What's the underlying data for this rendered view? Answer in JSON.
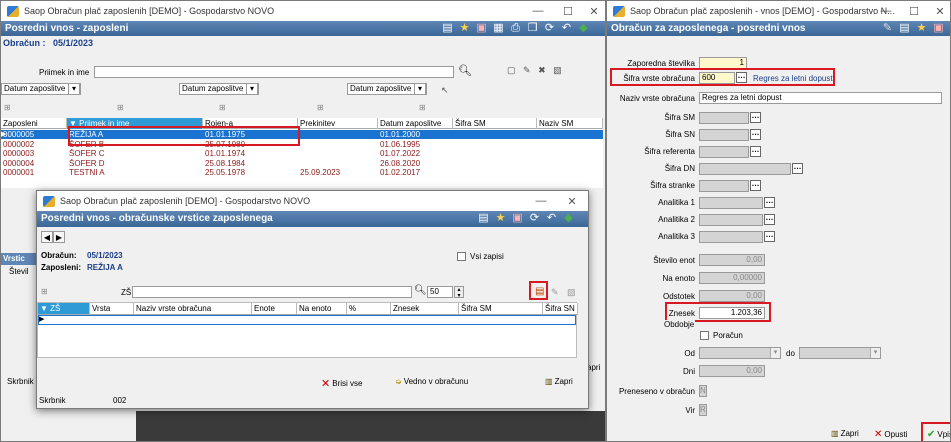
{
  "left_window": {
    "title": "Saop Obračun plač zaposlenih [DEMO] - Gospodarstvo NOVO",
    "band": "Posredni vnos - zaposleni",
    "obracun_label": "Obračun :",
    "obracun_value": "05/1/2023",
    "search_label": "Priimek in ime",
    "search_value": "",
    "date1": "Datum zaposlitve",
    "date2": "Datum zaposlitve",
    "date3": "Datum zaposlitve",
    "columns": [
      "Zaposleni",
      "Priimek in ime",
      "Rojen-a",
      "Prekinitev",
      "Datum zaposlitve",
      "Šifra SM",
      "Naziv SM"
    ],
    "rows": [
      [
        "0000005",
        "REŽIJA A",
        "01.01.1975",
        "",
        "01.01.2000",
        "",
        ""
      ],
      [
        "0000002",
        "ŠOFER B",
        "25.07.1980",
        "",
        "01.06.1995",
        "",
        ""
      ],
      [
        "0000003",
        "ŠOFER C",
        "01.01.1974",
        "",
        "01.07.2022",
        "",
        ""
      ],
      [
        "0000004",
        "ŠOFER D",
        "25.08.1984",
        "",
        "26.08.2020",
        "",
        ""
      ],
      [
        "0000001",
        "TESTNI A",
        "25.05.1978",
        "25.09.2023",
        "01.02.2017",
        "",
        ""
      ]
    ],
    "bottom_tab": "Vrstic",
    "bottom_col": "Števil",
    "skrbnik_label": "Skrbnik",
    "skrbnik_value": "0",
    "zapri_partial": "apri"
  },
  "mid_window": {
    "title": "Saop Obračun plač zaposlenih [DEMO] - Gospodarstvo NOVO",
    "band": "Posredni vnos - obračunske vrstice zaposlenega",
    "obracun_label": "Obračun:",
    "obracun_value": "05/1/2023",
    "zaposleni_label": "Zaposleni:",
    "zaposleni_value": "REŽIJA A",
    "vsi_zapisi": "Vsi zapisi",
    "zs_label": "ZŠ",
    "zs_value": "",
    "count_value": "50",
    "columns": [
      "▼ ZŠ",
      "Vrsta",
      "Naziv vrste obračuna",
      "Enote",
      "Na enoto",
      "%",
      "Znesek",
      "Šifra SM",
      "Šifra SN"
    ],
    "brisi": "Brisi vse",
    "vedno": "Vedno v obračunu",
    "zapri": "Zapri",
    "skrbnik_label": "Skrbnik",
    "skrbnik_value": "002"
  },
  "right_window": {
    "title": "Saop Obračun plač zaposlenih - vnos [DEMO] - Gospodarstvo N...",
    "band": "Obračun za zaposlenega - posredni vnos",
    "fields": {
      "zaporedna_label": "Zaporedna številka",
      "zaporedna_value": "1",
      "sifra_vrste_label": "Šifra vrste obračuna",
      "sifra_vrste_value": "600",
      "sifra_vrste_link": "Regres za letni dopust",
      "naziv_label": "Naziv vrste obračuna",
      "naziv_value": "Regres za letni dopust",
      "sifra_sm": "Šifra SM",
      "sifra_sn": "Šifra SN",
      "sifra_ref": "Šifra referenta",
      "sifra_dn": "Šifra DN",
      "sifra_str": "Šifra stranke",
      "an1": "Analitika 1",
      "an2": "Analitika 2",
      "an3": "Analitika 3",
      "stevilo_label": "Število enot",
      "stevilo_value": "0,00",
      "na_enoto_label": "Na enoto",
      "na_enoto_value": "0,00000",
      "odstotek_label": "Odstotek",
      "odstotek_value": "0,00",
      "znesek_label": "Znesek",
      "znesek_value": "1.203,36",
      "obdobje": "Obdobje",
      "poracun": "Poračun",
      "od": "Od",
      "do": "do",
      "dni": "Dni",
      "dni_value": "0,00",
      "preneseno_label": "Preneseno v obračun",
      "preneseno_value": "N",
      "vir_label": "Vir",
      "vir_value": "R"
    },
    "zapri": "Zapri",
    "opusti": "Opusti",
    "vpisi": "Vpiši"
  },
  "colors": {
    "band": "#3a6797",
    "highlight": "#1a73d1",
    "red": "#d71921",
    "rowtext": "#8b1a1a"
  }
}
